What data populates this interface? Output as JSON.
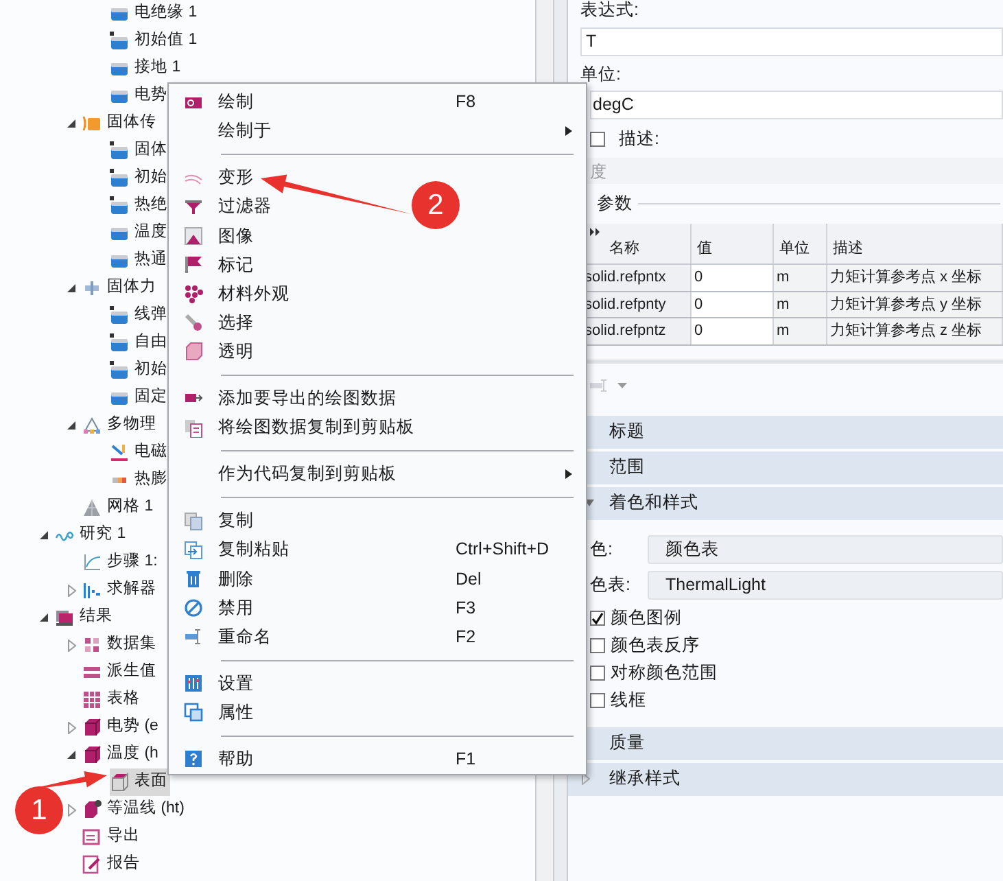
{
  "tree": [
    {
      "children": [
        {
          "children": [
            {
              "label": "电绝缘 1",
              "kind": "boundary",
              "selected": false
            },
            {
              "label": "初始值 1",
              "kind": "domain",
              "selected": false
            },
            {
              "label": "接地 1",
              "kind": "boundary",
              "selected": false
            },
            {
              "label": "电势",
              "kind": "boundary",
              "selected": false
            }
          ]
        },
        {
          "label": "固体传",
          "kind": "heat",
          "expanded": true,
          "selected": false,
          "children": [
            {
              "label": "固体",
              "kind": "domain",
              "selected": false
            },
            {
              "label": "初始",
              "kind": "domain",
              "selected": false
            },
            {
              "label": "热绝",
              "kind": "domain",
              "selected": false
            },
            {
              "label": "温度",
              "kind": "boundary",
              "selected": false
            },
            {
              "label": "热通",
              "kind": "boundary",
              "selected": false
            }
          ]
        },
        {
          "label": "固体力",
          "kind": "solid",
          "expanded": true,
          "selected": false,
          "children": [
            {
              "label": "线弹",
              "kind": "domain",
              "selected": false
            },
            {
              "label": "自由",
              "kind": "domain",
              "selected": false
            },
            {
              "label": "初始",
              "kind": "domain",
              "selected": false
            },
            {
              "label": "固定",
              "kind": "boundary",
              "selected": false
            }
          ]
        },
        {
          "label": "多物理",
          "kind": "multiphysics",
          "expanded": true,
          "selected": false,
          "children": [
            {
              "label": "电磁",
              "kind": "em",
              "selected": false
            },
            {
              "label": "热膨",
              "kind": "thermal",
              "selected": false
            }
          ]
        },
        {
          "label": "网格 1",
          "kind": "mesh",
          "selected": false
        }
      ]
    },
    {
      "label": "研究 1",
      "kind": "study",
      "expanded": true,
      "selected": false,
      "children": [
        {
          "label": "步骤 1:",
          "kind": "step",
          "selected": false
        },
        {
          "label": "求解器",
          "kind": "solver",
          "expanded": false,
          "selected": false
        }
      ]
    },
    {
      "label": "结果",
      "kind": "results",
      "expanded": true,
      "selected": false,
      "children": [
        {
          "label": "数据集",
          "kind": "dataset",
          "expanded": false,
          "selected": false
        },
        {
          "label": "派生值",
          "kind": "derived",
          "selected": false
        },
        {
          "label": "表格",
          "kind": "table",
          "selected": false
        },
        {
          "label": "电势 (e",
          "kind": "plot",
          "expanded": false,
          "selected": false
        },
        {
          "label": "温度 (h",
          "kind": "plot",
          "expanded": true,
          "selected": false,
          "children": [
            {
              "label": "表面",
              "kind": "surface",
              "selected": true
            }
          ]
        },
        {
          "label": "等温线 (ht)",
          "kind": "contour",
          "expanded": false,
          "selected": false
        },
        {
          "label": "导出",
          "kind": "export",
          "selected": false
        },
        {
          "label": "报告",
          "kind": "report",
          "selected": false
        }
      ]
    }
  ],
  "context_menu": [
    {
      "kind": "item",
      "label": "绘制",
      "shortcut": "F8"
    },
    {
      "kind": "submenu",
      "label": "绘制于"
    },
    {
      "kind": "separator"
    },
    {
      "kind": "item",
      "label": "变形"
    },
    {
      "kind": "item",
      "label": "过滤器"
    },
    {
      "kind": "item",
      "label": "图像"
    },
    {
      "kind": "item",
      "label": "标记"
    },
    {
      "kind": "item",
      "label": "材料外观"
    },
    {
      "kind": "item",
      "label": "选择"
    },
    {
      "kind": "item",
      "label": "透明"
    },
    {
      "kind": "separator"
    },
    {
      "kind": "item",
      "label": "添加要导出的绘图数据"
    },
    {
      "kind": "item",
      "label": "将绘图数据复制到剪贴板"
    },
    {
      "kind": "separator"
    },
    {
      "kind": "submenu",
      "label": "作为代码复制到剪贴板"
    },
    {
      "kind": "separator"
    },
    {
      "kind": "item",
      "label": "复制"
    },
    {
      "kind": "item",
      "label": "复制粘贴",
      "shortcut": "Ctrl+Shift+D"
    },
    {
      "kind": "item",
      "label": "删除",
      "shortcut": "Del"
    },
    {
      "kind": "item",
      "label": "禁用",
      "shortcut": "F3"
    },
    {
      "kind": "item",
      "label": "重命名",
      "shortcut": "F2"
    },
    {
      "kind": "separator"
    },
    {
      "kind": "item",
      "label": "设置"
    },
    {
      "kind": "item",
      "label": "属性"
    },
    {
      "kind": "separator"
    },
    {
      "kind": "item",
      "label": "帮助",
      "shortcut": "F1"
    }
  ],
  "settings": {
    "expression_label": "表达式:",
    "expression": "T",
    "unit_label": "单位:",
    "unit": "degC",
    "description": {
      "label": "描述:",
      "checked": false,
      "value": "度",
      "disabled": true
    },
    "parameters": {
      "title": "参数",
      "columns": [
        "名称",
        "值",
        "单位",
        "描述"
      ],
      "rows": [
        [
          "solid.refpntx",
          "0",
          "m",
          "力矩计算参考点 x 坐标"
        ],
        [
          "solid.refpnty",
          "0",
          "m",
          "力矩计算参考点 y 坐标"
        ],
        [
          "solid.refpntz",
          "0",
          "m",
          "力矩计算参考点 z 坐标"
        ]
      ]
    },
    "sections": [
      {
        "title": "标题"
      },
      {
        "title": "范围"
      },
      {
        "title": "着色和样式",
        "expanded": true
      }
    ],
    "coloring": {
      "label": "色:",
      "value": "颜色表"
    },
    "color_table": {
      "label": "色表:",
      "value": "ThermalLight"
    },
    "options": [
      {
        "label": "颜色图例",
        "checked": true
      },
      {
        "label": "颜色表反序",
        "checked": false
      },
      {
        "label": "对称颜色范围",
        "checked": false
      },
      {
        "label": "线框",
        "checked": false
      }
    ],
    "sections_after": [
      {
        "title": "质量"
      },
      {
        "title": "继承样式",
        "expanded": false
      }
    ]
  },
  "annotations": [
    {
      "label": "1"
    },
    {
      "label": "2"
    }
  ]
}
